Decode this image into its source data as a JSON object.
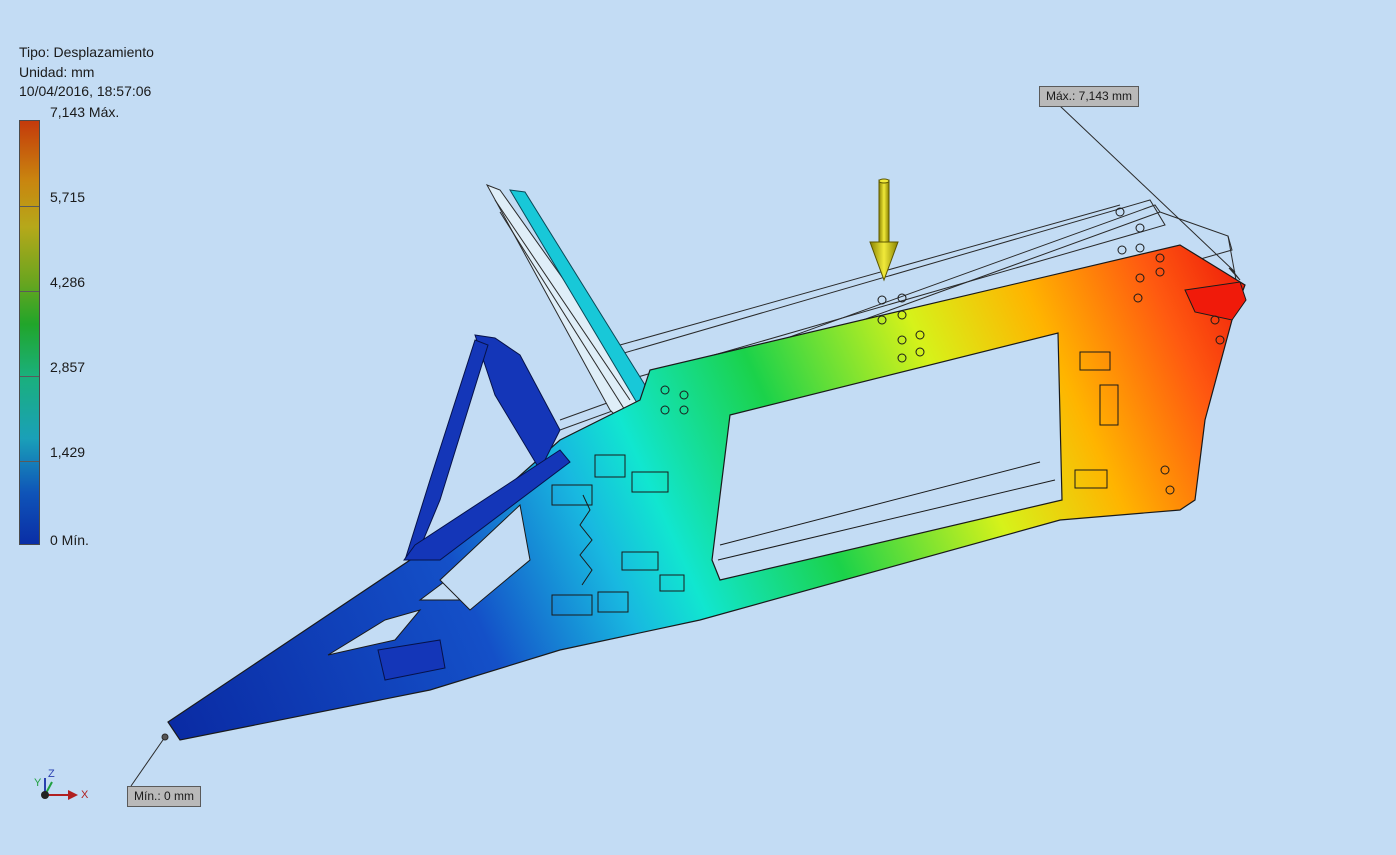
{
  "result_info": {
    "type_line": "Tipo: Desplazamiento",
    "unit_line": "Unidad: mm",
    "timestamp_line": "10/04/2016, 18:57:06"
  },
  "legend": {
    "max_label": "7,143 Máx.",
    "min_label": "0 Mín.",
    "ticks": [
      "5,715",
      "4,286",
      "2,857",
      "1,429"
    ],
    "scale_fraction_of_max": [
      0.8,
      0.6,
      0.4,
      0.2
    ],
    "colors": [
      "#0a2ea6",
      "#1aa0b8",
      "#21a52a",
      "#b6a81a",
      "#c43a0b"
    ]
  },
  "probes": {
    "max_label": "Máx.: 7,143 mm",
    "min_label": "Mín.: 0 mm"
  },
  "load": {
    "icon": "load-arrow-icon",
    "color": "#c9c21a"
  },
  "triad": {
    "x_label": "X",
    "y_label": "Y",
    "z_label": "Z"
  }
}
